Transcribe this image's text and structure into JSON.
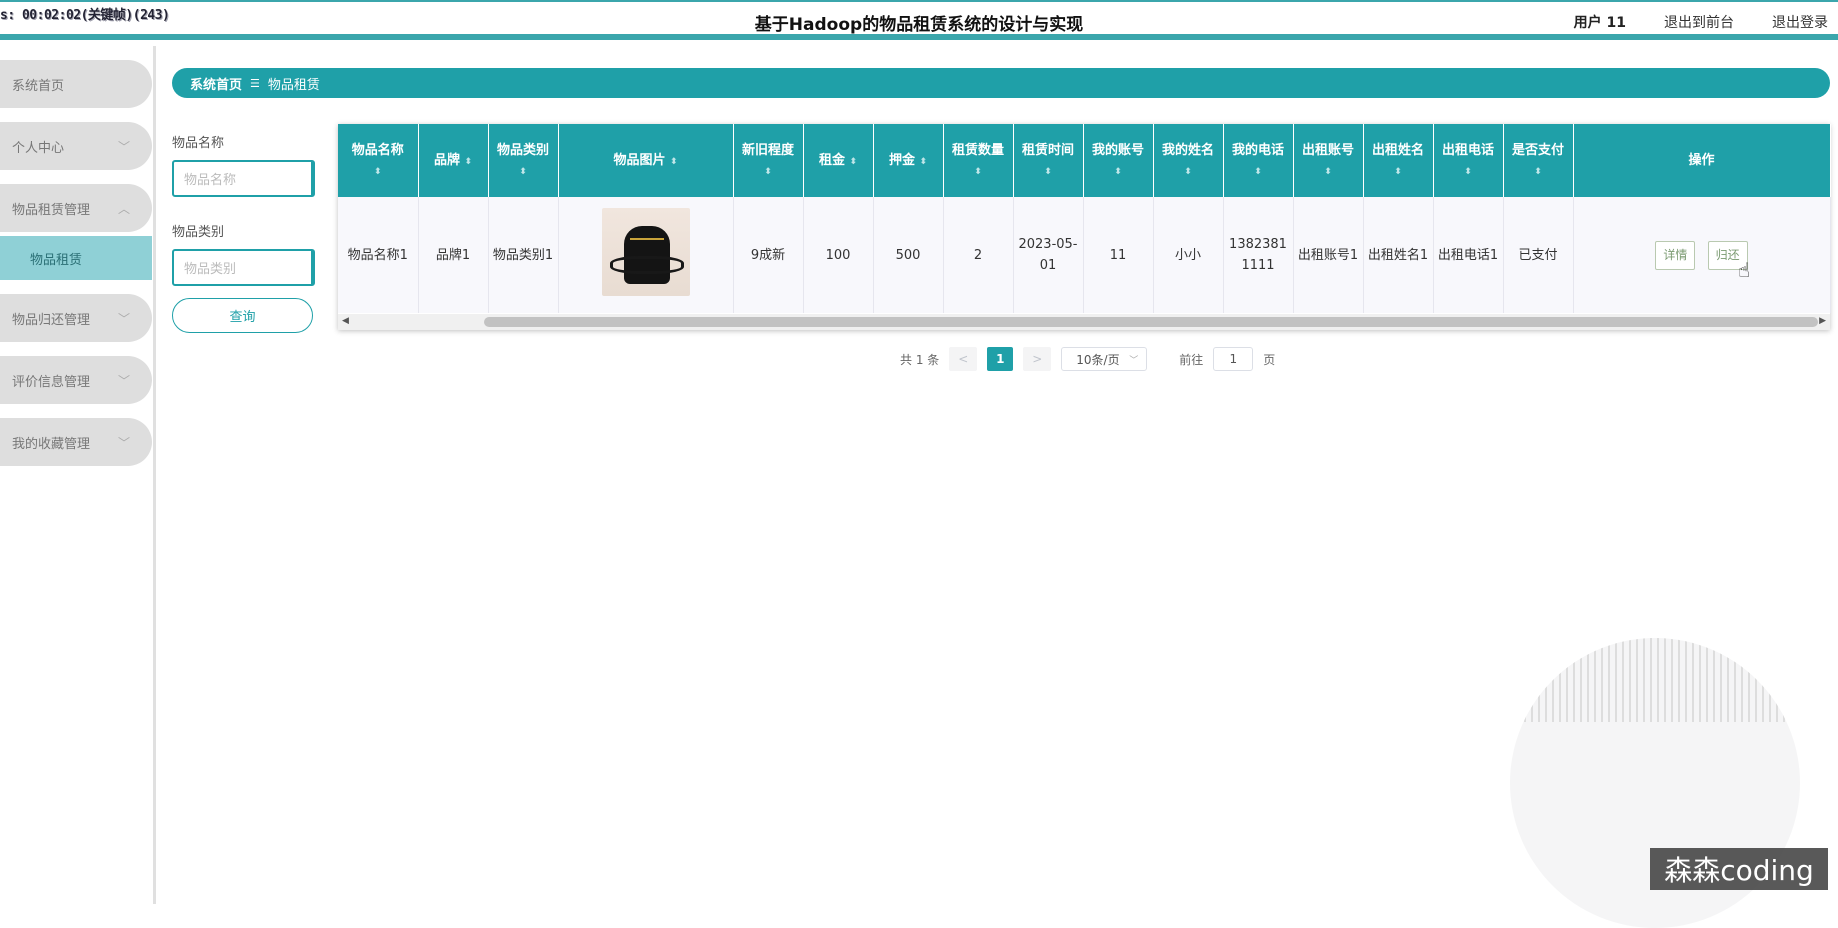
{
  "recording": "s: 00:02:02(关键帧)(243)",
  "header": {
    "title": "基于Hadoop的物品租赁系统的设计与实现",
    "user": "用户 11",
    "to_front": "退出到前台",
    "logout": "退出登录"
  },
  "sidebar": {
    "items": [
      {
        "label": "系统首页"
      },
      {
        "label": "个人中心"
      },
      {
        "label": "物品租赁管理"
      },
      {
        "label": "物品租赁"
      },
      {
        "label": "物品归还管理"
      },
      {
        "label": "评价信息管理"
      },
      {
        "label": "我的收藏管理"
      }
    ]
  },
  "breadcrumb": {
    "home": "系统首页",
    "sep": "☰",
    "current": "物品租赁"
  },
  "filter": {
    "name_label": "物品名称",
    "name_placeholder": "物品名称",
    "category_label": "物品类别",
    "category_placeholder": "物品类别",
    "search_button": "查询"
  },
  "table": {
    "columns": [
      "物品名称",
      "品牌",
      "物品类别",
      "物品图片",
      "新旧程度",
      "租金",
      "押金",
      "租赁数量",
      "租赁时间",
      "我的账号",
      "我的姓名",
      "我的电话",
      "出租账号",
      "出租姓名",
      "出租电话",
      "是否支付",
      "操作"
    ],
    "rows": [
      {
        "name": "物品名称1",
        "brand": "品牌1",
        "category": "物品类别1",
        "condition": "9成新",
        "rent": "100",
        "deposit": "500",
        "quantity": "2",
        "date": "2023-05-01",
        "my_account": "11",
        "my_name": "小小",
        "my_phone": "13823811111",
        "owner_account": "出租账号1",
        "owner_name": "出租姓名1",
        "owner_phone": "出租电话1",
        "paid": "已支付",
        "detail": "详情",
        "return": "归还"
      }
    ]
  },
  "pager": {
    "total": "共 1 条",
    "prev": "<",
    "current": "1",
    "next": ">",
    "size": "10条/页",
    "goto": "前往",
    "page_value": "1",
    "page_unit": "页"
  },
  "watermark": "森森coding"
}
